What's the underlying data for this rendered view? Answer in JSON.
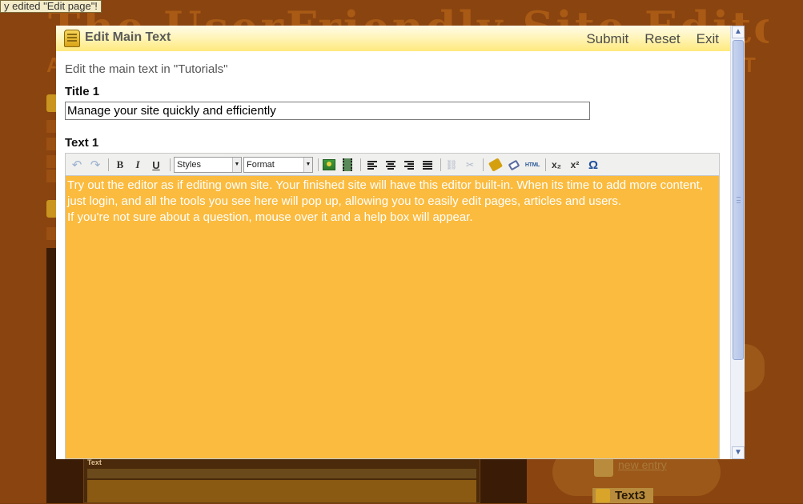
{
  "background": {
    "tooltip": "y edited \"Edit page\"!",
    "site_title": "The UserFriendly Site Editor",
    "new_entry": "new entry",
    "text3": "Text3",
    "mini_editor_label": "Text"
  },
  "dialog": {
    "title": "Edit Main Text",
    "actions": {
      "submit": "Submit",
      "reset": "Reset",
      "exit": "Exit"
    },
    "intro": "Edit the main text in \"Tutorials\"",
    "title1_label": "Title 1",
    "title1_value": "Manage your site quickly and efficiently",
    "text1_label": "Text 1"
  },
  "toolbar": {
    "styles": "Styles",
    "format": "Format",
    "bold": "B",
    "italic": "I",
    "underline": "U",
    "html": "HTML",
    "subscript": "x₂",
    "superscript": "x²",
    "special_char": "Ω"
  },
  "editor": {
    "paragraph1": "Try out the editor as if editing own site. Your finished site will have this editor built-in. When its time to add more content, just login, and all the tools you see here will pop up, allowing you to easily edit pages, articles and users.",
    "paragraph2": "If you're not sure about a question, mouse over it and a help box will appear."
  },
  "colors": {
    "background": "#8a4410",
    "titlebar": "#fff3b0",
    "editor_background": "#fbbb3e",
    "editor_text": "#ffffff"
  }
}
